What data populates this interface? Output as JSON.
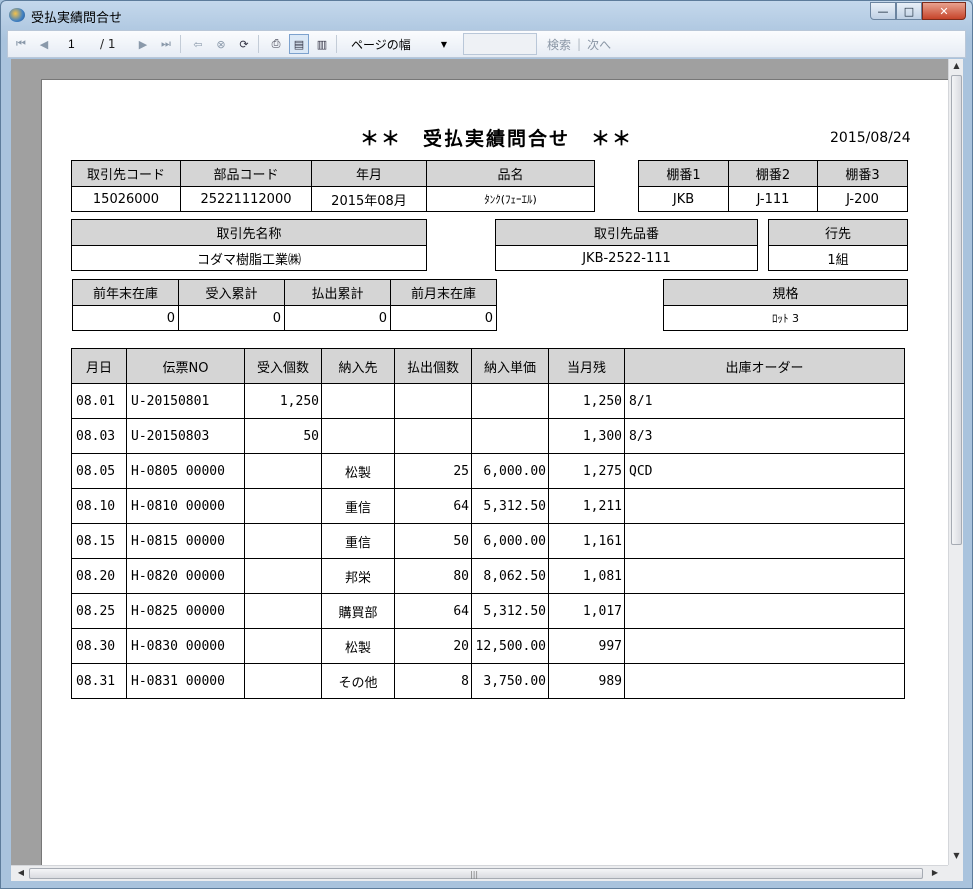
{
  "window": {
    "title": "受払実績問合せ",
    "minimize": "—",
    "maximize": "□",
    "close": "✕"
  },
  "toolbar": {
    "page_current": "1",
    "page_total": "/ 1",
    "zoom": "ページの幅",
    "search_value": "",
    "search_label": "検索",
    "next_label": "次へ",
    "separator": "|"
  },
  "report": {
    "title": "＊＊　受払実績問合せ　＊＊",
    "date": "2015/08/24",
    "box1": {
      "headers": [
        "取引先コード",
        "部品コード",
        "年月",
        "品名"
      ],
      "values": [
        "15026000",
        "25221112000",
        "2015年08月",
        "ﾀﾝｸ(ﾌｪｰｴﾙ)"
      ]
    },
    "box2": {
      "headers": [
        "棚番1",
        "棚番2",
        "棚番3"
      ],
      "values": [
        "JKB",
        "J-111",
        "J-200"
      ]
    },
    "box3": {
      "header": "取引先名称",
      "value": "コダマ樹脂工業㈱"
    },
    "box4": {
      "header": "取引先品番",
      "value": "JKB-2522-111"
    },
    "box5": {
      "header": "行先",
      "value": "1組"
    },
    "box6": {
      "headers": [
        "前年末在庫",
        "受入累計",
        "払出累計",
        "前月末在庫"
      ],
      "values": [
        "0",
        "0",
        "0",
        "0"
      ]
    },
    "box7": {
      "header": "規格",
      "value": "ﾛｯﾄ 3"
    },
    "detail": {
      "headers": [
        "月日",
        "伝票NO",
        "受入個数",
        "納入先",
        "払出個数",
        "納入単価",
        "当月残",
        "出庫オーダー"
      ],
      "rows": [
        [
          "08.01",
          "U-20150801",
          "1,250",
          "",
          "",
          "",
          "1,250",
          "8/1"
        ],
        [
          "08.03",
          "U-20150803",
          "50",
          "",
          "",
          "",
          "1,300",
          "8/3"
        ],
        [
          "08.05",
          "H-0805 00000",
          "",
          "松製",
          "25",
          "6,000.00",
          "1,275",
          "QCD"
        ],
        [
          "08.10",
          "H-0810 00000",
          "",
          "重信",
          "64",
          "5,312.50",
          "1,211",
          ""
        ],
        [
          "08.15",
          "H-0815 00000",
          "",
          "重信",
          "50",
          "6,000.00",
          "1,161",
          ""
        ],
        [
          "08.20",
          "H-0820 00000",
          "",
          "邦栄",
          "80",
          "8,062.50",
          "1,081",
          ""
        ],
        [
          "08.25",
          "H-0825 00000",
          "",
          "購買部",
          "64",
          "5,312.50",
          "1,017",
          ""
        ],
        [
          "08.30",
          "H-0830 00000",
          "",
          "松製",
          "20",
          "12,500.00",
          "997",
          ""
        ],
        [
          "08.31",
          "H-0831 00000",
          "",
          "その他",
          "8",
          "3,750.00",
          "989",
          ""
        ]
      ]
    }
  }
}
